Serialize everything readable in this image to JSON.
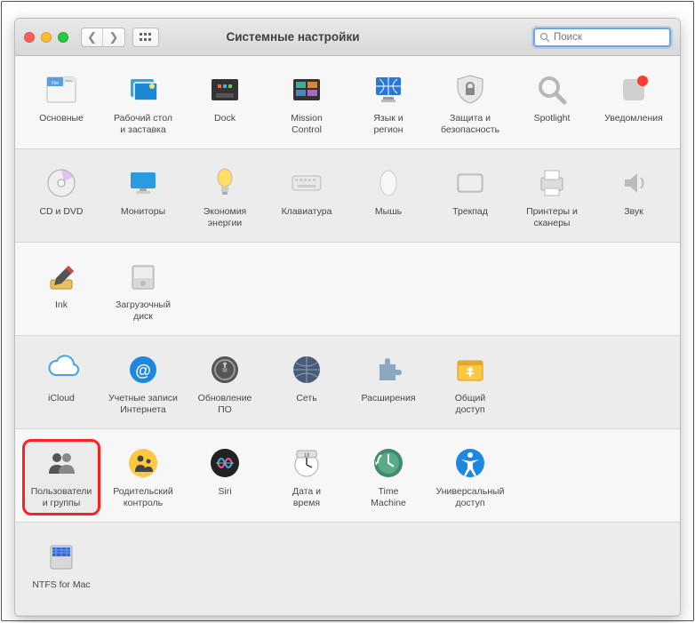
{
  "window": {
    "title": "Системные настройки"
  },
  "search": {
    "placeholder": "Поиск"
  },
  "rows": [
    [
      {
        "id": "general",
        "label": "Основные"
      },
      {
        "id": "desktop",
        "label": "Рабочий стол\nи заставка"
      },
      {
        "id": "dock",
        "label": "Dock"
      },
      {
        "id": "mission",
        "label": "Mission\nControl"
      },
      {
        "id": "language",
        "label": "Язык и\nрегион"
      },
      {
        "id": "security",
        "label": "Защита и\nбезопасность"
      },
      {
        "id": "spotlight",
        "label": "Spotlight"
      },
      {
        "id": "notifications",
        "label": "Уведомления"
      }
    ],
    [
      {
        "id": "cddvd",
        "label": "CD и DVD"
      },
      {
        "id": "displays",
        "label": "Мониторы"
      },
      {
        "id": "energy",
        "label": "Экономия\nэнергии"
      },
      {
        "id": "keyboard",
        "label": "Клавиатура"
      },
      {
        "id": "mouse",
        "label": "Мышь"
      },
      {
        "id": "trackpad",
        "label": "Трекпад"
      },
      {
        "id": "printers",
        "label": "Принтеры и\nсканеры"
      },
      {
        "id": "sound",
        "label": "Звук"
      }
    ],
    [
      {
        "id": "ink",
        "label": "Ink"
      },
      {
        "id": "startup",
        "label": "Загрузочный\nдиск"
      }
    ],
    [
      {
        "id": "icloud",
        "label": "iCloud"
      },
      {
        "id": "accounts",
        "label": "Учетные записи\nИнтернета"
      },
      {
        "id": "update",
        "label": "Обновление\nПО"
      },
      {
        "id": "network",
        "label": "Сеть"
      },
      {
        "id": "extensions",
        "label": "Расширения"
      },
      {
        "id": "sharing",
        "label": "Общий\nдоступ"
      }
    ],
    [
      {
        "id": "users",
        "label": "Пользователи\nи группы",
        "highlight": true
      },
      {
        "id": "parental",
        "label": "Родительский\nконтроль"
      },
      {
        "id": "siri",
        "label": "Siri"
      },
      {
        "id": "datetime",
        "label": "Дата и\nвремя"
      },
      {
        "id": "timemachine",
        "label": "Time\nMachine"
      },
      {
        "id": "accessibility",
        "label": "Универсальный\nдоступ"
      }
    ],
    [
      {
        "id": "ntfs",
        "label": "NTFS for Mac"
      }
    ]
  ]
}
